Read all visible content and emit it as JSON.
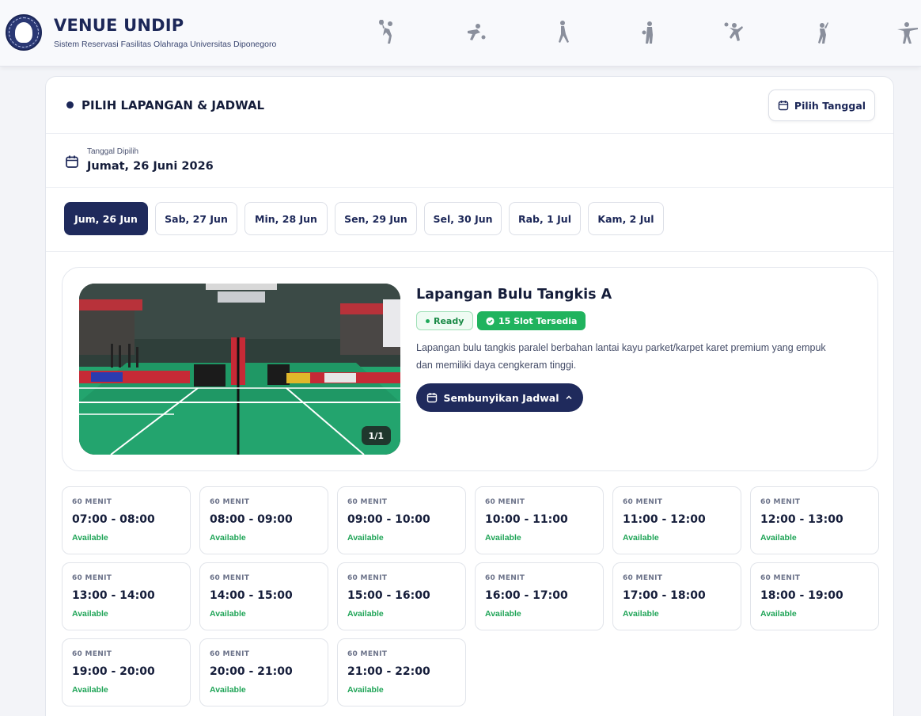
{
  "header": {
    "title": "VENUE UNDIP",
    "subtitle": "Sistem Reservasi Fasilitas Olahraga Universitas Diponegoro",
    "sport_icons": [
      "tennis-player-icon",
      "soccer-player-icon",
      "runner-icon",
      "basketball-player-icon",
      "volleyball-player-icon",
      "badminton-player-icon",
      "gymnast-icon"
    ]
  },
  "section": {
    "title": "PILIH LAPANGAN & JADWAL",
    "pick_date_label": "Pilih Tanggal"
  },
  "selected_date": {
    "label": "Tanggal Dipilih",
    "value": "Jumat, 26 Juni 2026"
  },
  "dates": [
    {
      "label": "Jum, 26 Jun",
      "active": true
    },
    {
      "label": "Sab, 27 Jun",
      "active": false
    },
    {
      "label": "Min, 28 Jun",
      "active": false
    },
    {
      "label": "Sen, 29 Jun",
      "active": false
    },
    {
      "label": "Sel, 30 Jun",
      "active": false
    },
    {
      "label": "Rab, 1 Jul",
      "active": false
    },
    {
      "label": "Kam, 2 Jul",
      "active": false
    }
  ],
  "court": {
    "name": "Lapangan Bulu Tangkis A",
    "status_badge": "Ready",
    "slots_badge": "15 Slot Tersedia",
    "description": "Lapangan bulu tangkis paralel berbahan lantai kayu parket/karpet karet premium yang empuk dan memiliki daya cengkeram tinggi.",
    "image_counter": "1/1",
    "toggle_schedule_label": "Sembunyikan Jadwal"
  },
  "slots": [
    {
      "duration": "60 MENIT",
      "time": "07:00 - 08:00",
      "status": "Available"
    },
    {
      "duration": "60 MENIT",
      "time": "08:00 - 09:00",
      "status": "Available"
    },
    {
      "duration": "60 MENIT",
      "time": "09:00 - 10:00",
      "status": "Available"
    },
    {
      "duration": "60 MENIT",
      "time": "10:00 - 11:00",
      "status": "Available"
    },
    {
      "duration": "60 MENIT",
      "time": "11:00 - 12:00",
      "status": "Available"
    },
    {
      "duration": "60 MENIT",
      "time": "12:00 - 13:00",
      "status": "Available"
    },
    {
      "duration": "60 MENIT",
      "time": "13:00 - 14:00",
      "status": "Available"
    },
    {
      "duration": "60 MENIT",
      "time": "14:00 - 15:00",
      "status": "Available"
    },
    {
      "duration": "60 MENIT",
      "time": "15:00 - 16:00",
      "status": "Available"
    },
    {
      "duration": "60 MENIT",
      "time": "16:00 - 17:00",
      "status": "Available"
    },
    {
      "duration": "60 MENIT",
      "time": "17:00 - 18:00",
      "status": "Available"
    },
    {
      "duration": "60 MENIT",
      "time": "18:00 - 19:00",
      "status": "Available"
    },
    {
      "duration": "60 MENIT",
      "time": "19:00 - 20:00",
      "status": "Available"
    },
    {
      "duration": "60 MENIT",
      "time": "20:00 - 21:00",
      "status": "Available"
    },
    {
      "duration": "60 MENIT",
      "time": "21:00 - 22:00",
      "status": "Available"
    }
  ],
  "colors": {
    "primary": "#1f2a5c",
    "success": "#20b35e",
    "available_text": "#1fa457"
  }
}
